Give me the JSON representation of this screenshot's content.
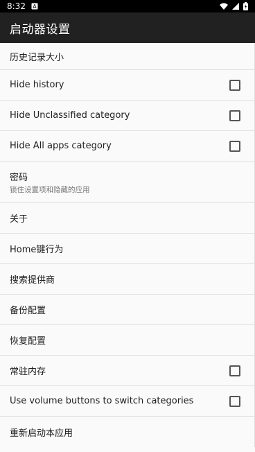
{
  "status": {
    "time": "8:32",
    "notification_icon": "sim-a-icon",
    "right_icons": [
      "wifi-icon",
      "signal-icon",
      "battery-icon"
    ]
  },
  "app_bar": {
    "title": "启动器设置"
  },
  "settings": {
    "history_size": {
      "title": "历史记录大小"
    },
    "hide_history": {
      "title": "Hide history",
      "checked": false
    },
    "hide_unclassified": {
      "title": "Hide Unclassified category",
      "checked": false
    },
    "hide_all_apps": {
      "title": "Hide All apps category",
      "checked": false
    },
    "password": {
      "title": "密码",
      "summary": "锁住设置项和隐藏的应用"
    },
    "about": {
      "title": "关于"
    },
    "home_key": {
      "title": "Home键行为"
    },
    "search_provider": {
      "title": "搜索提供商"
    },
    "backup": {
      "title": "备份配置"
    },
    "restore": {
      "title": "恢复配置"
    },
    "resident_memory": {
      "title": "常驻内存",
      "checked": false
    },
    "volume_buttons": {
      "title": "Use volume buttons to switch categories",
      "checked": false
    },
    "restart": {
      "title": "重新启动本应用"
    }
  },
  "colors": {
    "status_bar": "#000000",
    "app_bar": "#212121",
    "background": "#fafafa",
    "divider": "#e0e0e0"
  }
}
